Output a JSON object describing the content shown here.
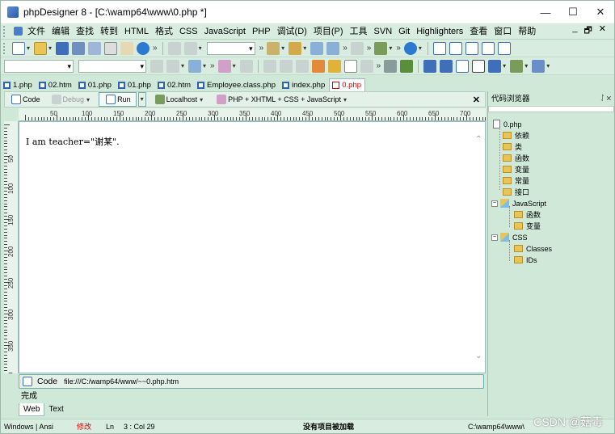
{
  "window": {
    "title": "phpDesigner 8 - [C:\\wamp64\\www\\0.php *]",
    "minimize": "—",
    "maximize": "☐",
    "close": "✕"
  },
  "menu": {
    "items": [
      "文件",
      "编辑",
      "查找",
      "转到",
      "HTML",
      "格式",
      "CSS",
      "JavaScript",
      "PHP",
      "调试(D)",
      "项目(P)",
      "工具",
      "SVN",
      "Git",
      "Highlighters",
      "查看",
      "窗口",
      "帮助"
    ],
    "right_controls": [
      "_",
      "🗗",
      "✕"
    ]
  },
  "tabs": [
    "1.php",
    "02.htm",
    "01.php",
    "01.php",
    "02.htm",
    "Employee.class.php",
    "index.php",
    "0.php"
  ],
  "active_tab_index": 7,
  "runbar": {
    "code_label": "Code",
    "debug_label": "Debug",
    "run_label": "Run",
    "localhost_label": "Localhost",
    "mode_label": "PHP + XHTML + CSS + JavaScript",
    "close": "✕"
  },
  "ruler": {
    "h_labels": [
      "50",
      "100",
      "150",
      "200",
      "250",
      "300",
      "350",
      "400",
      "450",
      "500",
      "550",
      "600",
      "650",
      "700"
    ],
    "v_labels": [
      "50",
      "100",
      "150",
      "200",
      "250",
      "300",
      "350",
      "400"
    ]
  },
  "editor": {
    "code": "I am teacher=\"谢某\"."
  },
  "codebar": {
    "label": "Code",
    "path": "file:///C:/wamp64/www/~~0.php.htm"
  },
  "status_done": "完成",
  "bottom_tabs": [
    "Web",
    "Text"
  ],
  "right_panel": {
    "title": "代码浏览器",
    "pin": "ᛇ ✕",
    "tree": {
      "root": "0.php",
      "php_children": [
        "依赖",
        "类",
        "函数",
        "变量",
        "常量",
        "接口"
      ],
      "js_label": "JavaScript",
      "js_children": [
        "函数",
        "变量"
      ],
      "css_label": "CSS",
      "css_children": [
        "Classes",
        "IDs"
      ]
    }
  },
  "statusbar": {
    "encoding": "Windows | Ansi",
    "modified": "修改",
    "ln": "Ln",
    "pos": "3 : Col  29",
    "project": "没有项目被加载",
    "path": "C:\\wamp64\\www\\"
  },
  "watermark": "CSDN @菇毒",
  "colors": {
    "accent": "#2d63b3",
    "modified": "#d00000",
    "panel": "#cfe8d8"
  }
}
